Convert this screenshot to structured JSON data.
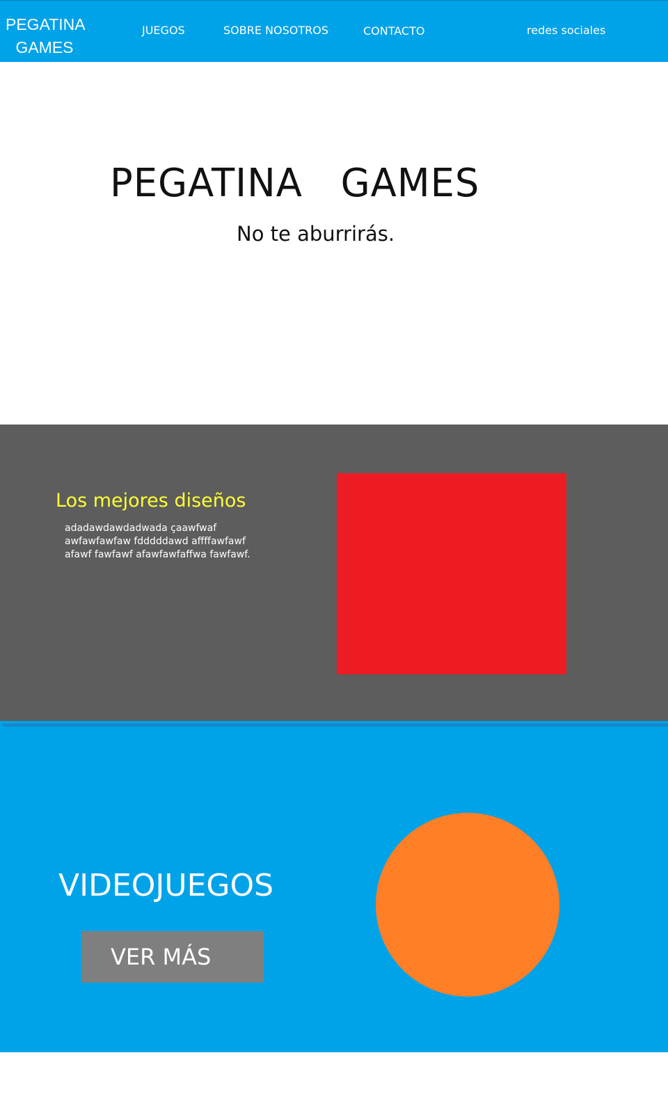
{
  "nav": {
    "logo": "PEGATINA\nGAMES",
    "links": [
      "JUEGOS",
      "SOBRE NOSOTROS",
      "CONTACTO",
      "redes sociales"
    ]
  },
  "hero": {
    "title": "PEGATINA   GAMES",
    "subtitle": "No te aburrirás."
  },
  "features": {
    "heading": "Los mejores diseños",
    "body": "adadawdawdadwada çaawfwaf\nawfawfawfaw fdddddawd affffawfawf\nafawf   fawfawf afawfawfaffwa fawfawf."
  },
  "games": {
    "title": "VIDEOJUEGOS",
    "button_label": "VER MÁS"
  },
  "colors": {
    "nav_background": "#00a2e8",
    "features_background": "#5d5d5d",
    "features_heading": "#ffff33",
    "art_background": "#ed1c24",
    "art_stroke": "#3f9bea",
    "games_background": "#00a2e8",
    "button_background": "#7f7f7f",
    "circle": "#ff7f27"
  }
}
